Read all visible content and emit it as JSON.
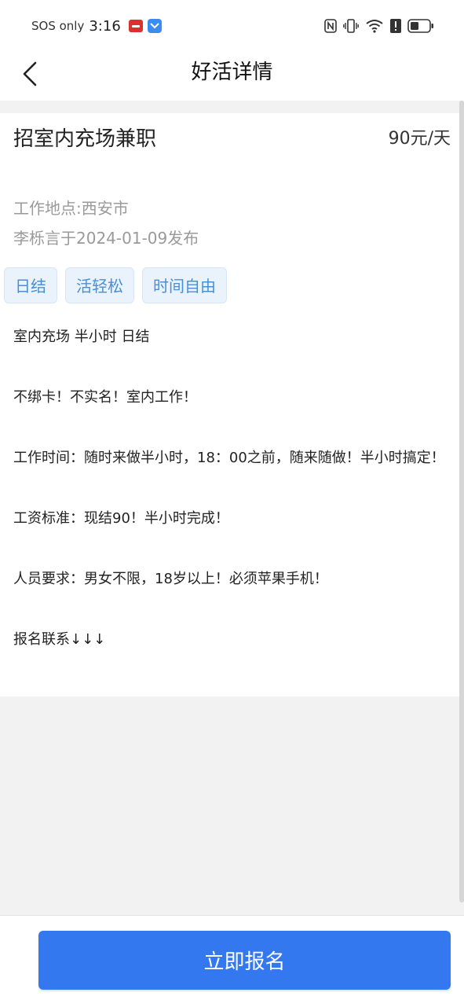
{
  "status_bar": {
    "carrier": "SOS only",
    "time": "3:16",
    "icons": [
      "notification-app-icon",
      "notification-app-icon-2",
      "nfc-icon",
      "vibrate-icon",
      "wifi-icon",
      "alert-icon",
      "battery-icon"
    ]
  },
  "navbar": {
    "back_icon": "chevron-left-icon",
    "title": "好活详情"
  },
  "job": {
    "title": "招室内充场兼职",
    "salary": "90元/天",
    "location": "工作地点:西安市",
    "publish_info": "李栎言于2024-01-09发布",
    "tags": [
      "日结",
      "活轻松",
      "时间自由"
    ],
    "description": [
      "室内充场 半小时 日结",
      "",
      "不绑卡！不实名！室内工作！",
      "",
      "工作时间：随时来做半小时，18：00之前，随来随做！半小时搞定！",
      "",
      "工资标准：现结90！半小时完成！",
      "",
      "人员要求：男女不限，18岁以上！必须苹果手机！",
      "",
      "报名联系↓↓↓"
    ]
  },
  "action": {
    "signup_label": "立即报名"
  },
  "colors": {
    "accent": "#3478f0",
    "tag_text": "#4a8fd6",
    "tag_bg": "#eaf3fc",
    "muted_text": "#9a9a9a",
    "page_bg": "#f2f2f2"
  }
}
